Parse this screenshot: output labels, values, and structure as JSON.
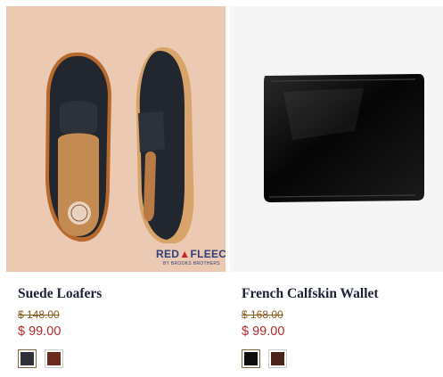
{
  "products": [
    {
      "title": "Suede Loafers",
      "was_price": "$ 148.00",
      "price": "$ 99.00",
      "image": "navy-suede-penny-loafers",
      "brand_logo": {
        "line1_a": "RED",
        "line1_b": "FLEECE",
        "line2": "BY BROOKS BROTHERS"
      },
      "swatches": [
        {
          "name": "navy",
          "color": "#2e3236",
          "selected": true
        },
        {
          "name": "brown",
          "color": "#6b2b1e",
          "selected": false
        }
      ]
    },
    {
      "title": "French Calfskin Wallet",
      "was_price": "$ 168.00",
      "price": "$ 99.00",
      "image": "black-leather-bifold-wallet",
      "swatches": [
        {
          "name": "black",
          "color": "#0d0d0d",
          "selected": true
        },
        {
          "name": "brown",
          "color": "#4a241a",
          "selected": false
        }
      ]
    }
  ],
  "colors": {
    "title": "#1a2233",
    "was_price": "#8a5a1c",
    "sale_price": "#b02a2a",
    "loafer_background": "#ecc9b2",
    "wallet_background": "#f5f5f5"
  }
}
